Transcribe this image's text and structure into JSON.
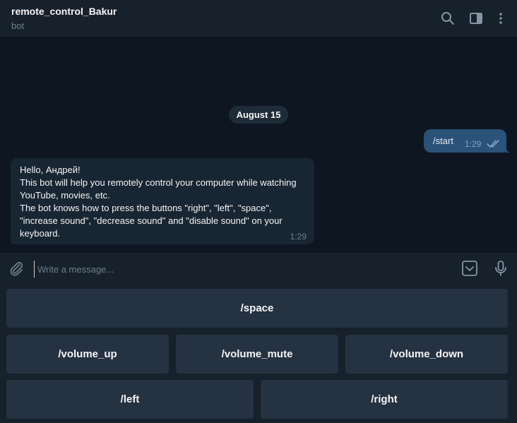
{
  "header": {
    "title": "remote_control_Bakur",
    "subtitle": "bot",
    "icons": [
      "search-icon",
      "sidebar-panel-icon",
      "more-vertical-icon"
    ]
  },
  "chat": {
    "date_separator": "August 15",
    "outgoing": {
      "text": "/start",
      "time": "1:29",
      "status": "read"
    },
    "incoming": {
      "text": "Hello, Андрей!\nThis bot will help you remotely control your computer while watching YouTube, movies, etc.\nThe bot knows how to press the buttons \"right\", \"left\", \"space\", \"increase sound\", \"decrease sound\" and \"disable sound\" on your keyboard.",
      "time": "1:29"
    }
  },
  "composer": {
    "placeholder": "Write a message...",
    "icons": [
      "paperclip-icon",
      "bot-keyboard-icon",
      "microphone-icon"
    ]
  },
  "keyboard": {
    "row1": [
      "/space"
    ],
    "row2": [
      "/volume_up",
      "/volume_mute",
      "/volume_down"
    ],
    "row3": [
      "/left",
      "/right"
    ]
  },
  "colors": {
    "background": "#0e1621",
    "panel": "#17212b",
    "outgoing_bubble": "#2b5278",
    "incoming_bubble": "#182533",
    "keyboard_button": "#253241",
    "muted_text": "#6d7f8f"
  }
}
